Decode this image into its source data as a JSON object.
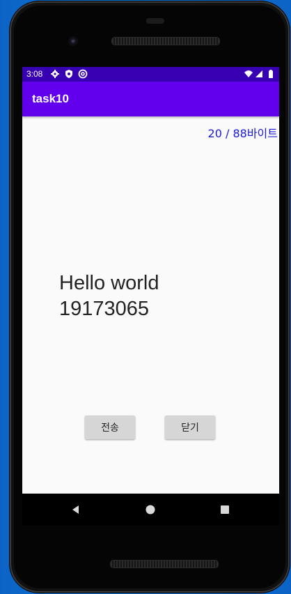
{
  "status_bar": {
    "time": "3:08",
    "left_icons": [
      "settings-icon",
      "shield-icon",
      "at-sign-icon"
    ],
    "right_icons": [
      "wifi-icon",
      "signal-icon",
      "battery-icon"
    ]
  },
  "app_bar": {
    "title": "task10"
  },
  "content": {
    "byte_counter": "20 / 88바이트",
    "message": "Hello world\n19173065"
  },
  "buttons": {
    "send_label": "전송",
    "close_label": "닫기"
  },
  "nav_bar": {
    "icons": [
      "back-icon",
      "home-icon",
      "recents-icon"
    ]
  },
  "colors": {
    "status_bar": "#3700b3",
    "app_bar": "#6200ee",
    "byte_counter": "#1a1ad6",
    "background": "#fafafa"
  }
}
